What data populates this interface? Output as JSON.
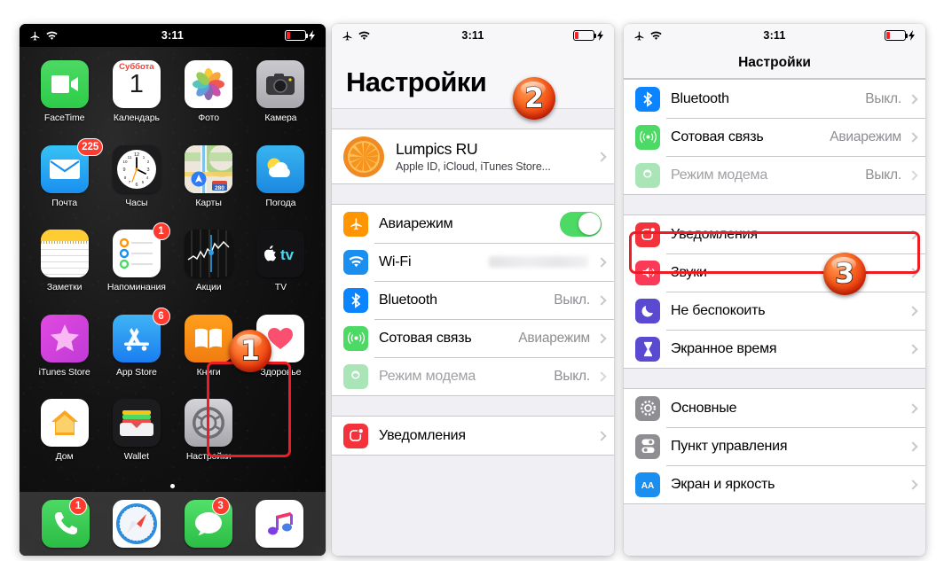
{
  "statusbar": {
    "time": "3:11",
    "airplane_icon": "airplane-icon",
    "wifi_icon": "wifi-icon",
    "battery_icon": "battery-low-icon",
    "charging_icon": "lightning-bolt-icon"
  },
  "home_screen": {
    "apps": [
      {
        "label": "FaceTime",
        "icon": "facetime-icon",
        "badge": null
      },
      {
        "label": "Календарь",
        "icon": "calendar-icon",
        "badge": null,
        "day_name": "Суббота",
        "day_number": "1"
      },
      {
        "label": "Фото",
        "icon": "photos-icon",
        "badge": null
      },
      {
        "label": "Камера",
        "icon": "camera-icon",
        "badge": null
      },
      {
        "label": "Почта",
        "icon": "mail-icon",
        "badge": "225"
      },
      {
        "label": "Часы",
        "icon": "clock-icon",
        "badge": null
      },
      {
        "label": "Карты",
        "icon": "maps-icon",
        "badge": null,
        "road_number": "280"
      },
      {
        "label": "Погода",
        "icon": "weather-icon",
        "badge": null
      },
      {
        "label": "Заметки",
        "icon": "notes-icon",
        "badge": null
      },
      {
        "label": "Напоминания",
        "icon": "reminders-icon",
        "badge": "1"
      },
      {
        "label": "Акции",
        "icon": "stocks-icon",
        "badge": null
      },
      {
        "label": "TV",
        "icon": "apple-tv-icon",
        "badge": null
      },
      {
        "label": "iTunes Store",
        "icon": "itunes-store-icon",
        "badge": null
      },
      {
        "label": "App Store",
        "icon": "app-store-icon",
        "badge": "6"
      },
      {
        "label": "Книги",
        "icon": "books-icon",
        "badge": null
      },
      {
        "label": "Здоровье",
        "icon": "health-icon",
        "badge": null
      },
      {
        "label": "Дом",
        "icon": "home-icon",
        "badge": null
      },
      {
        "label": "Wallet",
        "icon": "wallet-icon",
        "badge": null
      },
      {
        "label": "Настройки",
        "icon": "settings-gear-icon",
        "badge": null
      },
      {
        "label": "",
        "icon": "empty-slot",
        "badge": null
      }
    ],
    "dock": [
      {
        "label": "Телефон",
        "icon": "phone-icon",
        "badge": "1"
      },
      {
        "label": "Safari",
        "icon": "safari-icon",
        "badge": null
      },
      {
        "label": "Сообщения",
        "icon": "messages-icon",
        "badge": "3"
      },
      {
        "label": "Музыка",
        "icon": "music-icon",
        "badge": null
      }
    ]
  },
  "settings_main": {
    "title": "Настройки",
    "account": {
      "name": "Lumpics RU",
      "subtitle": "Apple ID, iCloud, iTunes Store...",
      "avatar_icon": "orange-slice-avatar"
    },
    "rows": [
      {
        "label": "Авиарежим",
        "icon": "airplane-mode-icon",
        "value": null,
        "control": "toggle",
        "toggle_on": true,
        "dim": false
      },
      {
        "label": "Wi-Fi",
        "icon": "wifi-settings-icon",
        "value": null,
        "control": "blurred",
        "dim": false
      },
      {
        "label": "Bluetooth",
        "icon": "bluetooth-icon",
        "value": "Выкл.",
        "control": "chevron",
        "dim": false
      },
      {
        "label": "Сотовая связь",
        "icon": "cellular-icon",
        "value": "Авиарежим",
        "control": "chevron",
        "dim": false
      },
      {
        "label": "Режим модема",
        "icon": "hotspot-icon",
        "value": "Выкл.",
        "control": "chevron",
        "dim": true
      }
    ],
    "notifications_row": {
      "label": "Уведомления",
      "icon": "notifications-icon",
      "control": "chevron"
    }
  },
  "settings_scrolled": {
    "nav_title": "Настройки",
    "group1": [
      {
        "label": "Bluetooth",
        "icon": "bluetooth-icon",
        "value": "Выкл.",
        "dim": false
      },
      {
        "label": "Сотовая связь",
        "icon": "cellular-icon",
        "value": "Авиарежим",
        "dim": false
      },
      {
        "label": "Режим модема",
        "icon": "hotspot-icon",
        "value": "Выкл.",
        "dim": true
      }
    ],
    "group2": [
      {
        "label": "Уведомления",
        "icon": "notifications-icon",
        "value": null,
        "highlighted": true
      },
      {
        "label": "Звуки",
        "icon": "sounds-icon",
        "value": null,
        "highlighted": false
      },
      {
        "label": "Не беспокоить",
        "icon": "do-not-disturb-icon",
        "value": null,
        "highlighted": false
      },
      {
        "label": "Экранное время",
        "icon": "screen-time-icon",
        "value": null,
        "highlighted": false
      }
    ],
    "group3": [
      {
        "label": "Основные",
        "icon": "general-gear-icon",
        "value": null
      },
      {
        "label": "Пункт управления",
        "icon": "control-center-icon",
        "value": null
      },
      {
        "label": "Экран и яркость",
        "icon": "display-brightness-icon",
        "value": null
      }
    ]
  },
  "annotations": {
    "steps": [
      {
        "number": "1"
      },
      {
        "number": "2"
      },
      {
        "number": "3"
      }
    ],
    "highlight_color": "#ee1c25"
  }
}
